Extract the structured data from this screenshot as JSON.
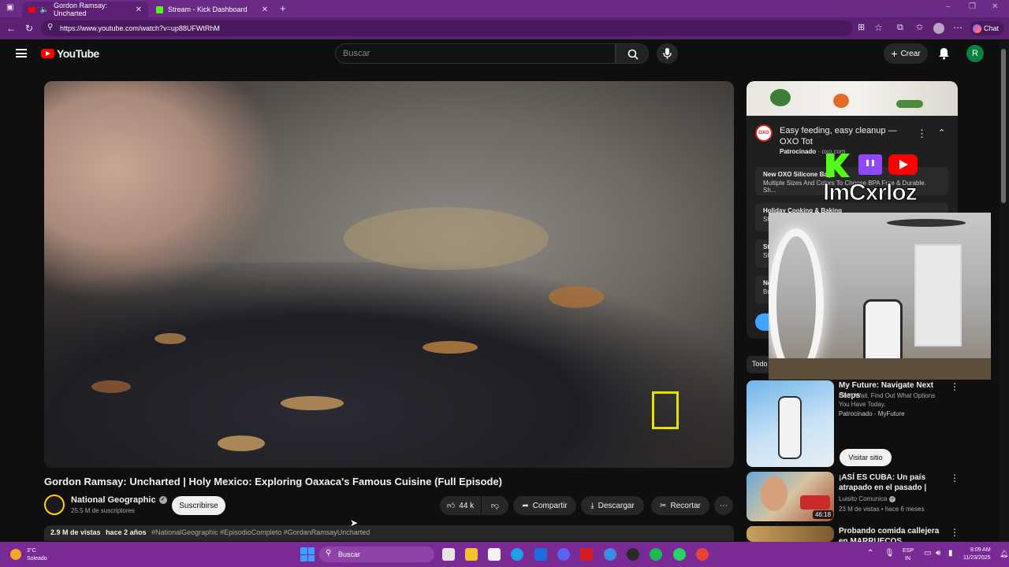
{
  "browser": {
    "tabs": [
      {
        "title": "Gordon Ramsay: Uncharted"
      },
      {
        "title": "Stream - Kick Dashboard"
      }
    ],
    "url": "https://www.youtube.com/watch?v=up88UFWtRhM",
    "chat_label": "Chat",
    "accent": "#5c2173"
  },
  "youtube": {
    "logo_text": "YouTube",
    "search_placeholder": "Buscar",
    "create_label": "Crear",
    "avatar_letter": "R"
  },
  "video": {
    "title": "Gordon Ramsay: Uncharted | Holy Mexico: Exploring Oaxaca's Famous Cuisine (Full Episode)",
    "channel": "National Geographic",
    "subscribers": "25.5 M de suscriptores",
    "subscribe_label": "Suscribirse",
    "likes": "44 k",
    "share_label": "Compartir",
    "download_label": "Descargar",
    "clip_label": "Recortar",
    "views": "2.9 M de vistas",
    "age": "hace 2 años",
    "hashtags": "#NationalGeographic #EpisodioCompleto #GordanRamsayUncharted"
  },
  "sidebar": {
    "ad": {
      "title": "Easy feeding, easy cleanup — OXO Tot",
      "sponsor_label": "Patrocinado",
      "domain": "oxo.com",
      "links": [
        {
          "title": "New OXO Silicone Bags",
          "desc": "Multiple Sizes And Colors To Choose BPA Free & Durable. Sh..."
        },
        {
          "title": "Holiday Cooking & Baking",
          "desc": "Sh"
        },
        {
          "title": "St",
          "desc": "Sh"
        },
        {
          "title": "Ne",
          "desc": "Bu"
        }
      ]
    },
    "filter_label": "Todo",
    "recommendations": [
      {
        "title": "My Future: Navigate Next Steps",
        "line1": "Don't Wait. Find Out What Options",
        "line2": "You Have Today.",
        "meta": "Patrocinado · MyFuture",
        "action": "Visitar sitio"
      },
      {
        "title": "¡ASÍ ES CUBA: Un país atrapado en el pasado | ¿Cómo vive la ...",
        "channel": "Luisito Comunica",
        "meta": "23 M de vistas • hace 6 meses",
        "duration": "46:18"
      },
      {
        "title": "Probando comida callejera en MARRUECOS",
        "channel": "",
        "meta": "",
        "duration": ""
      }
    ]
  },
  "stream_overlay": {
    "streamer_name": "lmCxrloz"
  },
  "taskbar": {
    "weather_temp": "3°C",
    "weather_desc": "Soleado",
    "search_label": "Buscar",
    "lang_top": "ESP",
    "lang_bottom": "IN",
    "time": "8:09 AM",
    "date": "11/23/2025"
  }
}
